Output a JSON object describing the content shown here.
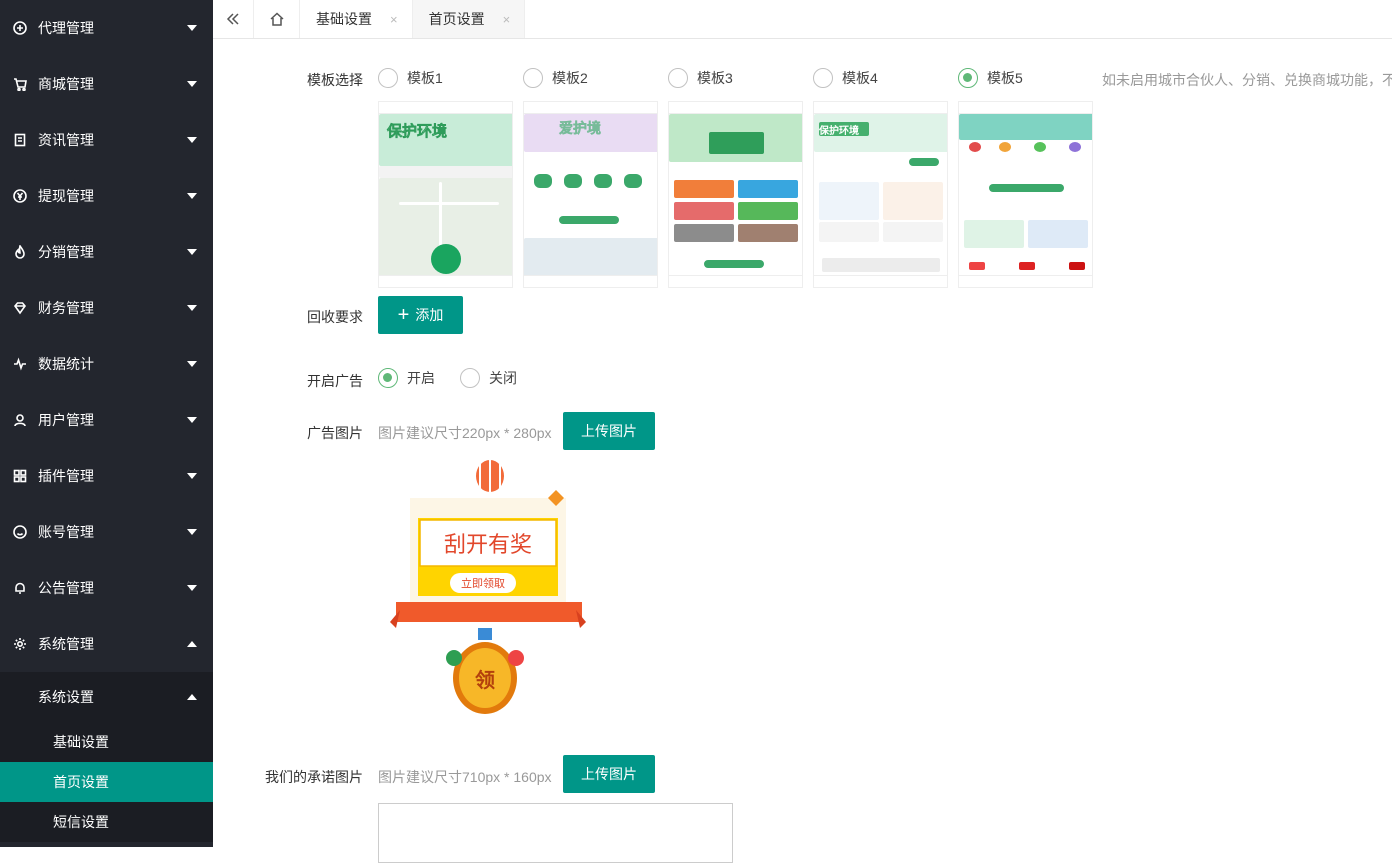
{
  "sidebar": {
    "items": [
      {
        "label": "代理管理",
        "icon": "plus-circle-icon"
      },
      {
        "label": "商城管理",
        "icon": "cart-icon"
      },
      {
        "label": "资讯管理",
        "icon": "document-icon"
      },
      {
        "label": "提现管理",
        "icon": "yen-icon"
      },
      {
        "label": "分销管理",
        "icon": "fire-icon"
      },
      {
        "label": "财务管理",
        "icon": "diamond-icon"
      },
      {
        "label": "数据统计",
        "icon": "pulse-icon"
      },
      {
        "label": "用户管理",
        "icon": "user-icon"
      },
      {
        "label": "插件管理",
        "icon": "grid-icon"
      },
      {
        "label": "账号管理",
        "icon": "smile-icon"
      },
      {
        "label": "公告管理",
        "icon": "bell-icon"
      },
      {
        "label": "系统管理",
        "icon": "gear-icon"
      }
    ],
    "sub_head": "系统设置",
    "sub_items": [
      "基础设置",
      "首页设置",
      "短信设置"
    ],
    "active_sub": "首页设置",
    "accent": "#009688"
  },
  "tabs": [
    {
      "label": "基础设置",
      "close": "×"
    },
    {
      "label": "首页设置",
      "close": "×"
    }
  ],
  "form": {
    "template_label": "模板选择",
    "templates": [
      "模板1",
      "模板2",
      "模板3",
      "模板4",
      "模板5"
    ],
    "selected_template": "模板5",
    "template_hint": "如未启用城市合伙人、分销、兑换商城功能，不",
    "recycle_label": "回收要求",
    "add_button": "添加",
    "ad_label": "开启广告",
    "ad_on": "开启",
    "ad_off": "关闭",
    "ad_image_label": "广告图片",
    "ad_image_hint": "图片建议尺寸220px * 280px",
    "upload_button": "上传图片",
    "promise_label": "我们的承诺图片",
    "promise_hint": "图片建议尺寸710px * 160px",
    "promise_upload_button": "上传图片"
  },
  "thumbs": {
    "t1_banner": "保护环境",
    "t2_banner": "爱护境",
    "t4_banner": "保护环境"
  },
  "ad": {
    "title": "刮开有奖",
    "button": "立即领取",
    "coin": "领"
  }
}
